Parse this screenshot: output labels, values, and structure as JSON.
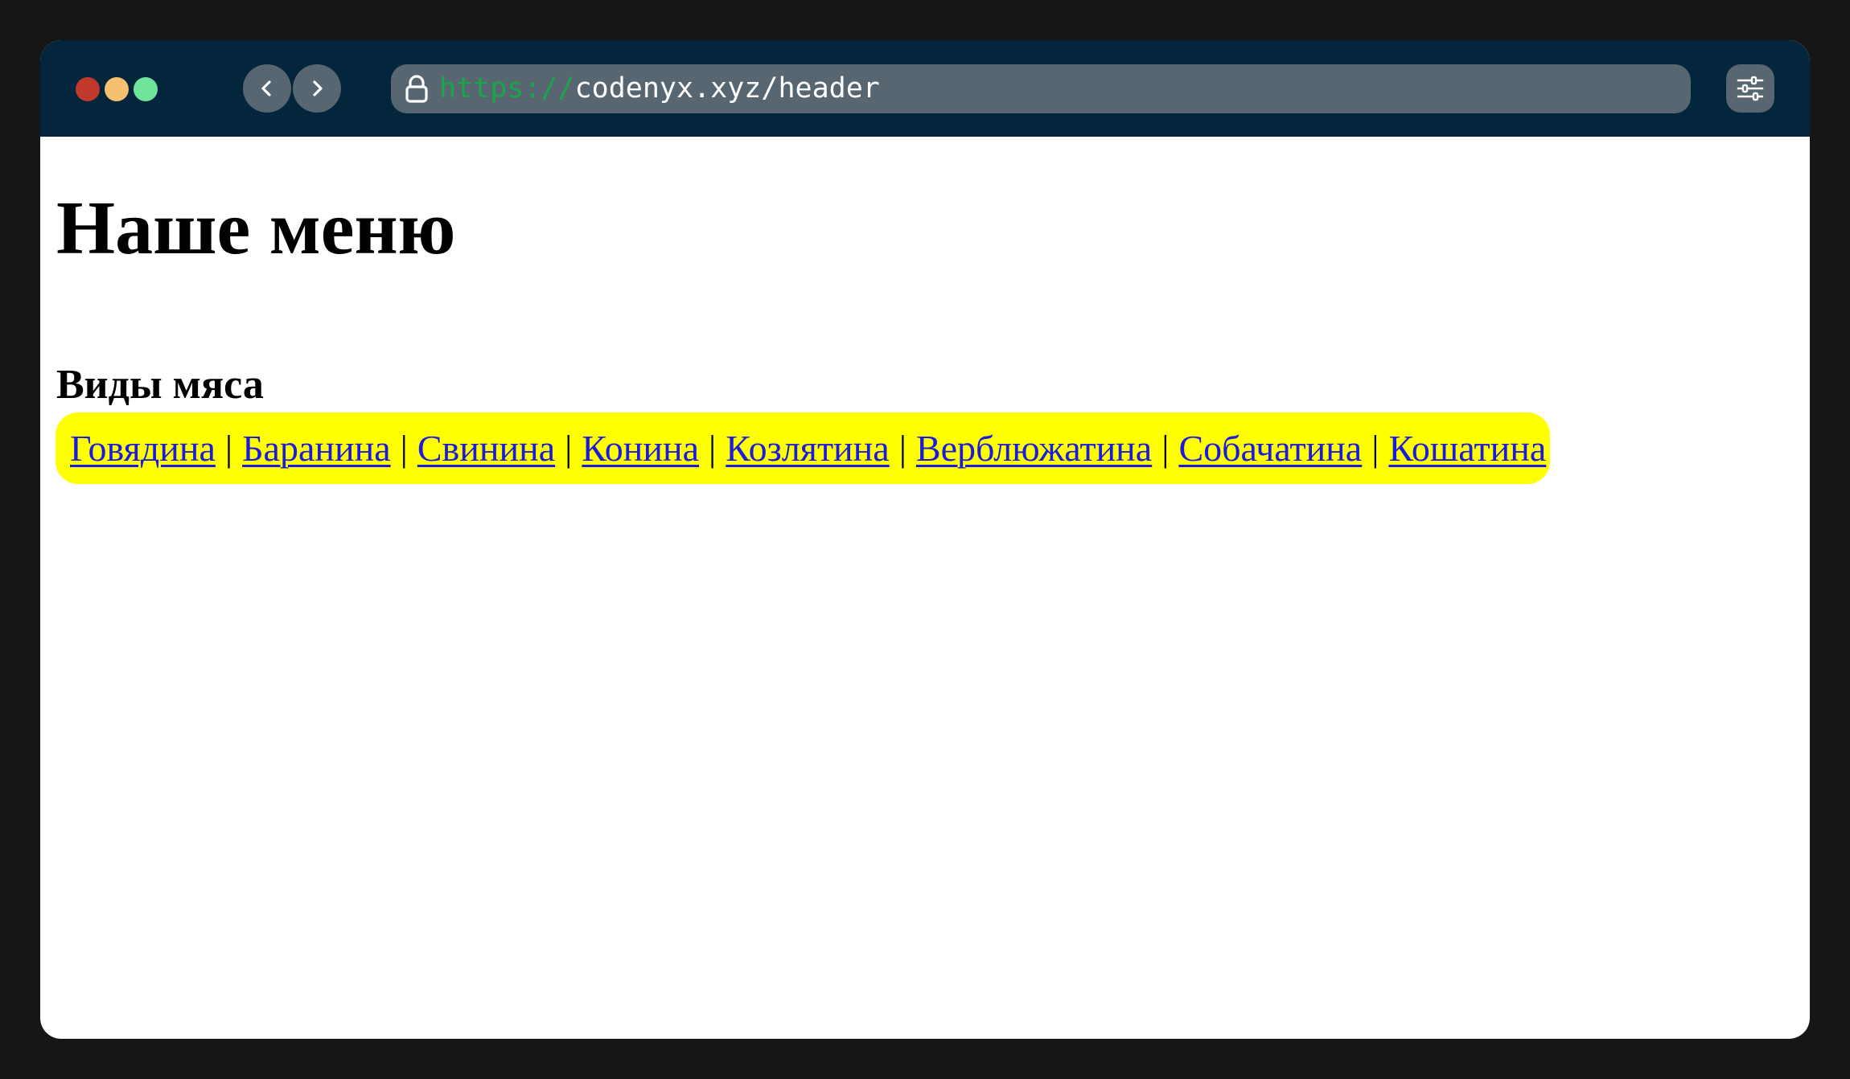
{
  "browser": {
    "url_scheme": "https://",
    "url_rest": "codenyx.xyz/header",
    "traffic_lights": {
      "close": "#c0392b",
      "minimize": "#f5c06f",
      "maximize": "#6fe49a"
    },
    "icons": {
      "back": "chevron-left-icon",
      "forward": "chevron-right-icon",
      "lock": "lock-icon",
      "settings": "sliders-icon"
    }
  },
  "page": {
    "title": "Наше меню",
    "section_title": "Виды мяса",
    "nav_separator": "|",
    "nav_background": "#ffff00",
    "link_color": "#1a1ae0",
    "nav_links": [
      "Говядина",
      "Баранина",
      "Свинина",
      "Конина",
      "Козлятина",
      "Верблюжатина",
      "Собачатина",
      "Кошатина"
    ]
  }
}
